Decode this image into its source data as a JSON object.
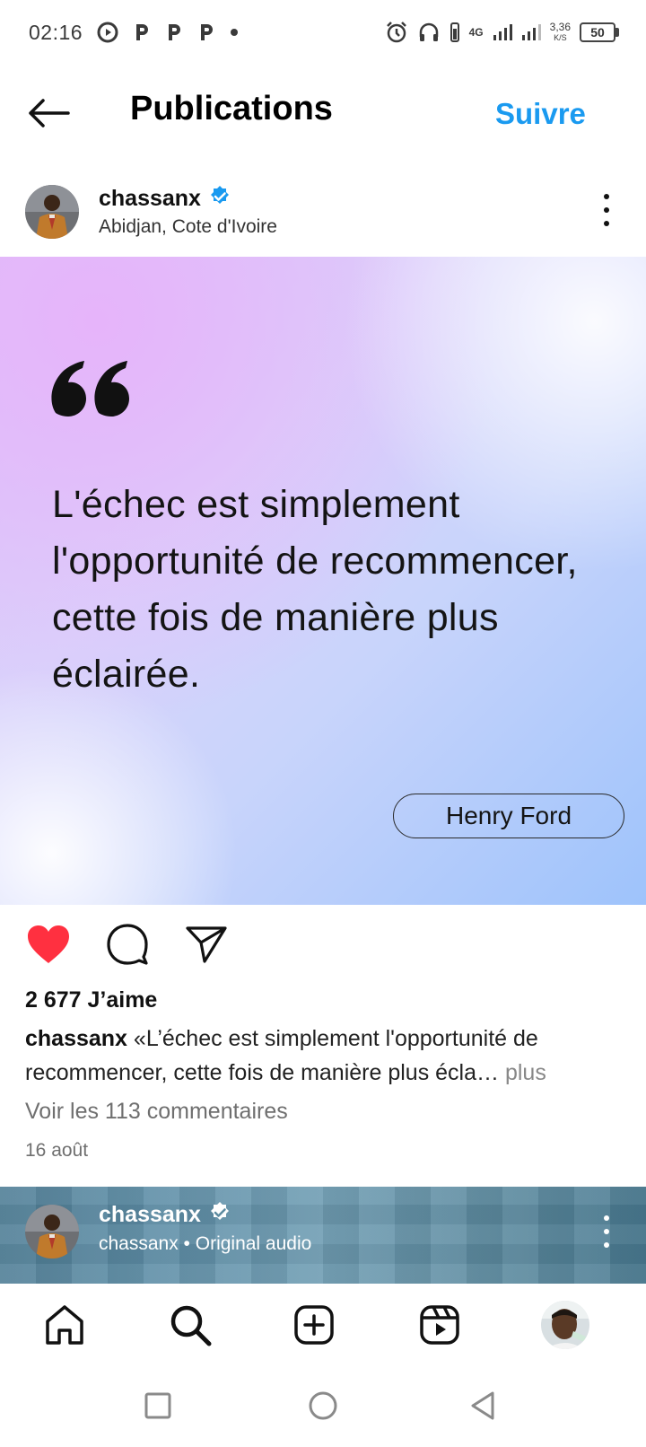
{
  "status_bar": {
    "time": "02:16",
    "network": "4G",
    "speed_value": "3,36",
    "speed_unit": "K/S",
    "battery": "50"
  },
  "header": {
    "title": "Publications",
    "follow_label": "Suivre"
  },
  "post": {
    "username": "chassanx",
    "location": "Abidjan, Cote d'Ivoire",
    "quote_text": "L'échec est simplement l'opportunité de recommencer, cette fois de manière plus éclairée.",
    "quote_author": "Henry Ford",
    "likes": "2 677 J’aime",
    "caption_user": "chassanx",
    "caption_text": " «L’échec est simplement l'opportunité de recommencer, cette fois de manière plus écla… ",
    "caption_more": "plus",
    "view_comments": "Voir les 113 commentaires",
    "date": "16 août",
    "liked": true,
    "like_color": "#ff3040"
  },
  "next_post": {
    "username": "chassanx",
    "subtitle": "chassanx • Original audio"
  },
  "colors": {
    "accent": "#1a9af0",
    "verified": "#1a9af0"
  },
  "bottom_nav": [
    "home-icon",
    "search-icon",
    "create-icon",
    "reels-icon",
    "profile-avatar"
  ],
  "system_nav": [
    "recents-square",
    "home-circle",
    "back-triangle"
  ]
}
